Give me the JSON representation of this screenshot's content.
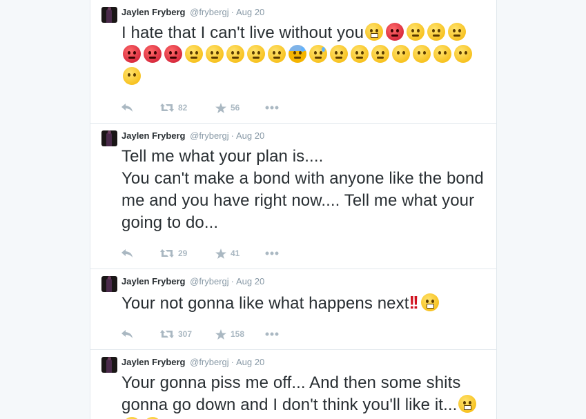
{
  "tweets": [
    {
      "name": "Jaylen Fryberg",
      "handle": "@frybergj",
      "sep": "·",
      "time": "Aug 20",
      "text": "I hate that I can't live without you",
      "emojis": [
        "steam",
        "red",
        "tired",
        "relieved",
        "tired",
        "red",
        "red",
        "red",
        "persevere",
        "unamused",
        "unamused",
        "unamused",
        "unamused",
        "sweat",
        "sad-sweat",
        "worried",
        "worried",
        "worried",
        "blank",
        "blank",
        "blank",
        "blank",
        "blank"
      ],
      "retweets": "82",
      "favorites": "56"
    },
    {
      "name": "Jaylen Fryberg",
      "handle": "@frybergj",
      "sep": "·",
      "time": "Aug 20",
      "text": "Tell me what your plan is....\nYou can't make a bond with anyone like the bond me and you have right now.... Tell me what your going to do...",
      "emojis": [],
      "retweets": "29",
      "favorites": "41"
    },
    {
      "name": "Jaylen Fryberg",
      "handle": "@frybergj",
      "sep": "·",
      "time": "Aug 20",
      "text": "Your not gonna like what happens next",
      "bang": "!!",
      "emojis": [
        "steam"
      ],
      "retweets": "307",
      "favorites": "158"
    },
    {
      "name": "Jaylen Fryberg",
      "handle": "@frybergj",
      "sep": "·",
      "time": "Aug 20",
      "text": "Your gonna piss me off... And then some shits gonna go down and I don't think you'll like it...",
      "emojis": [
        "steam",
        "steam",
        "steam"
      ],
      "retweets": "",
      "favorites": ""
    }
  ],
  "colors": {
    "text": "#292f33",
    "muted": "#8899a6",
    "icon": "#aab8c2",
    "border": "#e1e8ed"
  },
  "icons": {
    "reply": "reply-icon",
    "retweet": "retweet-icon",
    "favorite": "star-icon",
    "more": "more-icon"
  }
}
